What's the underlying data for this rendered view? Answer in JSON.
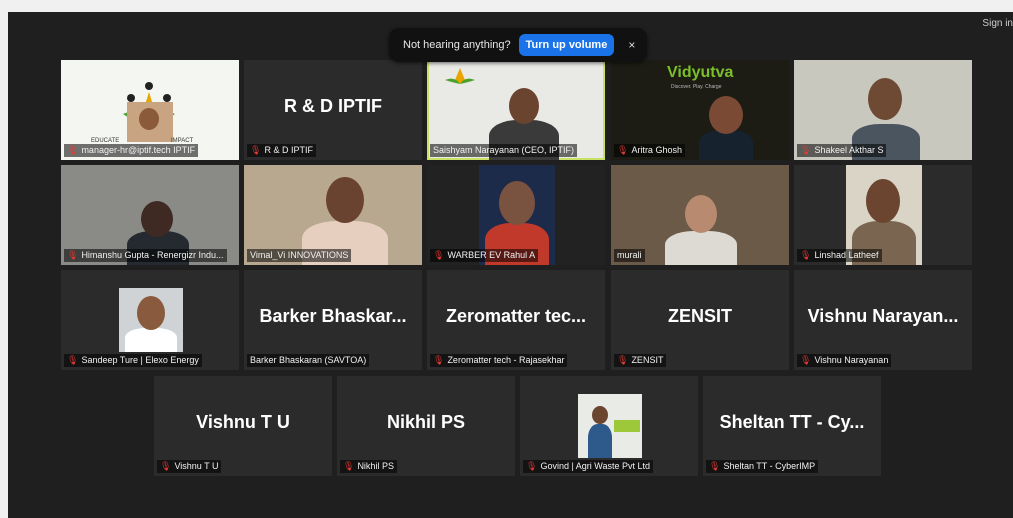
{
  "header": {
    "sign_in": "Sign in"
  },
  "toast": {
    "message": "Not hearing anything?",
    "button": "Turn up volume",
    "close": "×"
  },
  "tiles": [
    {
      "name": "manager-hr@iptif.tech IPTIF",
      "muted": true
    },
    {
      "name": "R & D IPTIF",
      "muted": true,
      "big": "R & D IPTIF"
    },
    {
      "name": "Saishyam Narayanan (CEO, IPTIF)",
      "muted": false
    },
    {
      "name": "Aritra Ghosh",
      "muted": true
    },
    {
      "name": "Shakeel Akthar S",
      "muted": true
    },
    {
      "name": "Himanshu Gupta - Renergizr Indu...",
      "muted": true
    },
    {
      "name": "Vimal_Vi INNOVATIONS",
      "muted": false
    },
    {
      "name": "WARBER EV Rahul A",
      "muted": true
    },
    {
      "name": "murali",
      "muted": false
    },
    {
      "name": "Linshad Latheef",
      "muted": true
    },
    {
      "name": "Sandeep Ture | Elexo Energy",
      "muted": true
    },
    {
      "name": "Barker Bhaskaran (SAVTOA)",
      "muted": false,
      "big": "Barker Bhaskar..."
    },
    {
      "name": "Zeromatter tech - Rajasekhar",
      "muted": true,
      "big": "Zeromatter tec..."
    },
    {
      "name": "ZENSIT",
      "muted": true,
      "big": "ZENSIT"
    },
    {
      "name": "Vishnu Narayanan",
      "muted": true,
      "big": "Vishnu Narayan..."
    },
    {
      "name": "Vishnu T U",
      "muted": true,
      "big": "Vishnu T U"
    },
    {
      "name": "Nikhil PS",
      "muted": true,
      "big": "Nikhil PS"
    },
    {
      "name": "Govind | Agri Waste Pvt Ltd",
      "muted": true
    },
    {
      "name": "Sheltan TT - CyberIMP",
      "muted": true,
      "big": "Sheltan TT - Cy..."
    }
  ],
  "logo_text": {
    "iptif_left": "EDUCATE",
    "iptif_right": "IMPACT",
    "vidyutva": "Vidyutva",
    "vidyutva_tag": "Discover. Play. Charge"
  }
}
